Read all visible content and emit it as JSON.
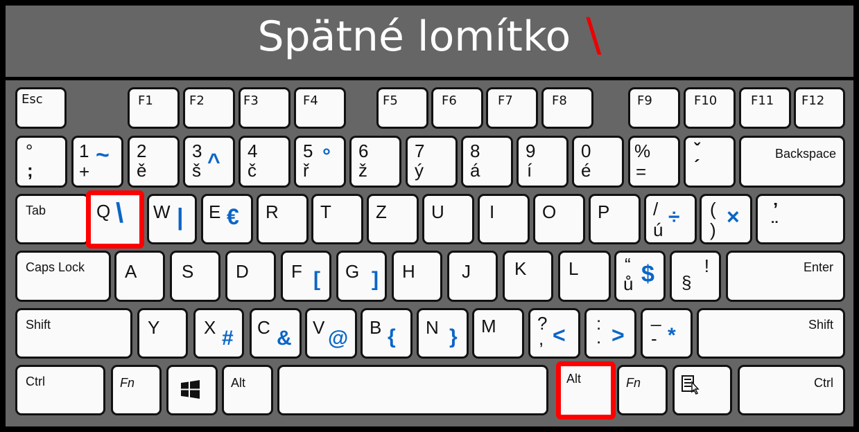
{
  "title": {
    "text": "Spätné lomítko",
    "symbol": "\\",
    "symbol_color": "#e00000"
  },
  "colors": {
    "background": "#666666",
    "key": "#fafafa",
    "highlight": "#ff0000",
    "blue_symbol": "#0a66c8"
  },
  "rows": {
    "function": [
      {
        "id": "esc",
        "label": "Esc"
      },
      {
        "id": "f1",
        "label": "F1"
      },
      {
        "id": "f2",
        "label": "F2"
      },
      {
        "id": "f3",
        "label": "F3"
      },
      {
        "id": "f4",
        "label": "F4"
      },
      {
        "id": "f5",
        "label": "F5"
      },
      {
        "id": "f6",
        "label": "F6"
      },
      {
        "id": "f7",
        "label": "F7"
      },
      {
        "id": "f8",
        "label": "F8"
      },
      {
        "id": "f9",
        "label": "F9"
      },
      {
        "id": "f10",
        "label": "F10"
      },
      {
        "id": "f11",
        "label": "F11"
      },
      {
        "id": "f12",
        "label": "F12"
      }
    ],
    "number": [
      {
        "id": "semicolon",
        "top": "°",
        "bottom": ";",
        "alt": ""
      },
      {
        "id": "1",
        "top": "1",
        "bottom": "+",
        "alt": "~"
      },
      {
        "id": "2",
        "top": "2",
        "bottom": "ě",
        "alt": ""
      },
      {
        "id": "3",
        "top": "3",
        "bottom": "š",
        "alt": "^"
      },
      {
        "id": "4",
        "top": "4",
        "bottom": "č",
        "alt": ""
      },
      {
        "id": "5",
        "top": "5",
        "bottom": "ř",
        "alt": "°"
      },
      {
        "id": "6",
        "top": "6",
        "bottom": "ž",
        "alt": ""
      },
      {
        "id": "7",
        "top": "7",
        "bottom": "ý",
        "alt": ""
      },
      {
        "id": "8",
        "top": "8",
        "bottom": "á",
        "alt": ""
      },
      {
        "id": "9",
        "top": "9",
        "bottom": "í",
        "alt": ""
      },
      {
        "id": "0",
        "top": "0",
        "bottom": "é",
        "alt": ""
      },
      {
        "id": "equals",
        "top": "%",
        "bottom": "=",
        "alt": ""
      },
      {
        "id": "acute",
        "top": "ˇ",
        "bottom": "´",
        "alt": ""
      },
      {
        "id": "backspace",
        "label": "Backspace"
      }
    ],
    "top": [
      {
        "id": "tab",
        "label": "Tab"
      },
      {
        "id": "q",
        "top": "Q",
        "alt": "\\"
      },
      {
        "id": "w",
        "top": "W",
        "alt": "|"
      },
      {
        "id": "e",
        "top": "E",
        "alt": "€"
      },
      {
        "id": "r",
        "top": "R",
        "alt": ""
      },
      {
        "id": "t",
        "top": "T",
        "alt": ""
      },
      {
        "id": "z",
        "top": "Z",
        "alt": ""
      },
      {
        "id": "u",
        "top": "U",
        "alt": ""
      },
      {
        "id": "i",
        "top": "I",
        "alt": ""
      },
      {
        "id": "o",
        "top": "O",
        "alt": ""
      },
      {
        "id": "p",
        "top": "P",
        "alt": ""
      },
      {
        "id": "uacute",
        "top": "/",
        "bottom": "ú",
        "alt": "÷"
      },
      {
        "id": "paren",
        "top": "(",
        "bottom": ")",
        "alt": "×"
      },
      {
        "id": "diaeresis",
        "top": "’",
        "bottom": "¨",
        "alt": ""
      }
    ],
    "home": [
      {
        "id": "capslock",
        "label": "Caps Lock"
      },
      {
        "id": "a",
        "top": "A",
        "alt": ""
      },
      {
        "id": "s",
        "top": "S",
        "alt": ""
      },
      {
        "id": "d",
        "top": "D",
        "alt": ""
      },
      {
        "id": "f",
        "top": "F",
        "alt": "["
      },
      {
        "id": "g",
        "top": "G",
        "alt": "]"
      },
      {
        "id": "h",
        "top": "H",
        "alt": ""
      },
      {
        "id": "j",
        "top": "J",
        "alt": ""
      },
      {
        "id": "k",
        "top": "K",
        "alt": ""
      },
      {
        "id": "l",
        "top": "L",
        "alt": ""
      },
      {
        "id": "uring",
        "top": "“",
        "bottom": "ů",
        "alt": "$"
      },
      {
        "id": "section",
        "top": "!",
        "bottom": "§",
        "alt": ""
      },
      {
        "id": "enter",
        "label": "Enter"
      }
    ],
    "bottom": [
      {
        "id": "lshift",
        "label": "Shift"
      },
      {
        "id": "y",
        "top": "Y",
        "alt": ""
      },
      {
        "id": "x",
        "top": "X",
        "alt": "#"
      },
      {
        "id": "c",
        "top": "C",
        "alt": "&"
      },
      {
        "id": "v",
        "top": "V",
        "alt": "@"
      },
      {
        "id": "b",
        "top": "B",
        "alt": "{"
      },
      {
        "id": "n",
        "top": "N",
        "alt": "}"
      },
      {
        "id": "m",
        "top": "M",
        "alt": ""
      },
      {
        "id": "comma",
        "top": "?",
        "bottom": ",",
        "alt": "<"
      },
      {
        "id": "period",
        "top": ":",
        "bottom": ".",
        "alt": ">"
      },
      {
        "id": "minus",
        "top": "_",
        "bottom": "-",
        "alt": "*"
      },
      {
        "id": "rshift",
        "label": "Shift"
      }
    ],
    "space": [
      {
        "id": "lctrl",
        "label": "Ctrl"
      },
      {
        "id": "lfn",
        "label": "Fn"
      },
      {
        "id": "win",
        "icon": "windows-icon"
      },
      {
        "id": "lalt",
        "label": "Alt"
      },
      {
        "id": "space",
        "label": ""
      },
      {
        "id": "altgr",
        "label": "Alt"
      },
      {
        "id": "rfn",
        "label": "Fn"
      },
      {
        "id": "menu",
        "icon": "context-menu-icon"
      },
      {
        "id": "rctrl",
        "label": "Ctrl"
      }
    ]
  },
  "highlighted_keys": [
    "q",
    "altgr"
  ]
}
